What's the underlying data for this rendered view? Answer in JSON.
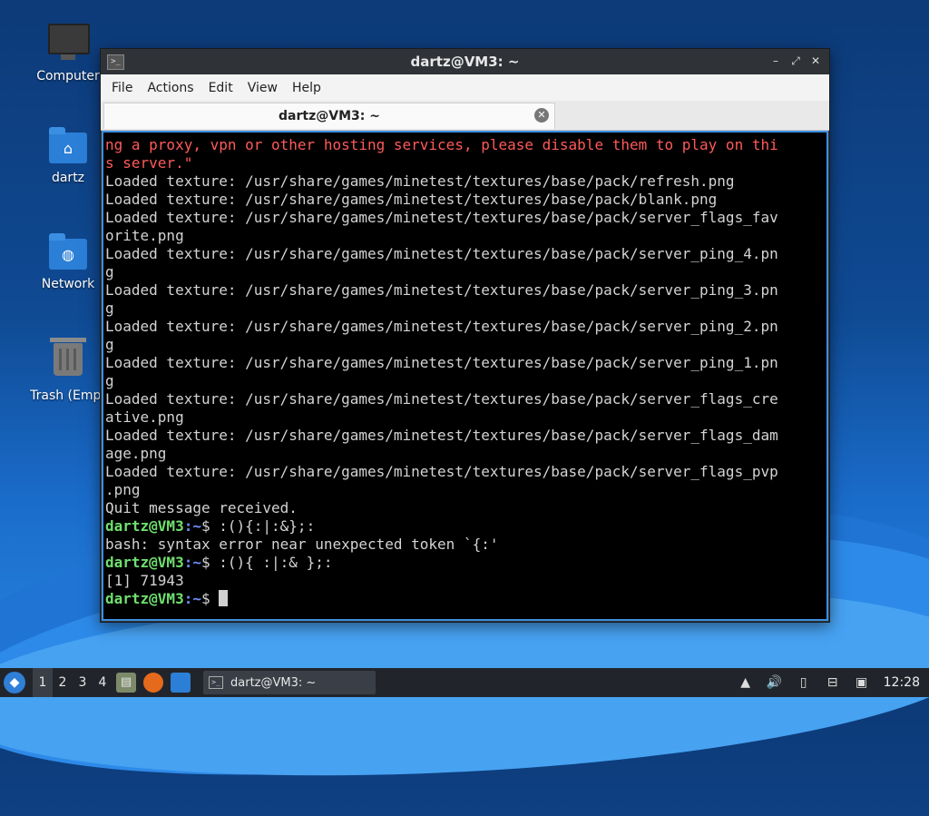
{
  "desktop": {
    "icons": [
      {
        "label": "Computer",
        "icon": "computer-icon"
      },
      {
        "label": "dartz",
        "icon": "home-folder-icon"
      },
      {
        "label": "Network",
        "icon": "network-folder-icon"
      },
      {
        "label": "Trash (Empt",
        "icon": "trash-icon"
      }
    ]
  },
  "window": {
    "title": "dartz@VM3: ~",
    "menu": [
      "File",
      "Actions",
      "Edit",
      "View",
      "Help"
    ],
    "tab_label": "dartz@VM3: ~",
    "controls": {
      "minimize": "–",
      "maximize": "⤢",
      "close": "✕"
    }
  },
  "terminal": {
    "error_lines": [
      "ng a proxy, vpn or other hosting services, please disable them to play on thi",
      "s server.\""
    ],
    "output_lines": [
      "Loaded texture: /usr/share/games/minetest/textures/base/pack/refresh.png",
      "Loaded texture: /usr/share/games/minetest/textures/base/pack/blank.png",
      "Loaded texture: /usr/share/games/minetest/textures/base/pack/server_flags_fav",
      "orite.png",
      "Loaded texture: /usr/share/games/minetest/textures/base/pack/server_ping_4.pn",
      "g",
      "Loaded texture: /usr/share/games/minetest/textures/base/pack/server_ping_3.pn",
      "g",
      "Loaded texture: /usr/share/games/minetest/textures/base/pack/server_ping_2.pn",
      "g",
      "Loaded texture: /usr/share/games/minetest/textures/base/pack/server_ping_1.pn",
      "g",
      "Loaded texture: /usr/share/games/minetest/textures/base/pack/server_flags_cre",
      "ative.png",
      "Loaded texture: /usr/share/games/minetest/textures/base/pack/server_flags_dam",
      "age.png",
      "Loaded texture: /usr/share/games/minetest/textures/base/pack/server_flags_pvp",
      ".png",
      "Quit message received."
    ],
    "prompt_user": "dartz@VM3",
    "prompt_path": ":~",
    "prompt_symbol": "$ ",
    "cmd1": ":(){:|:&};:",
    "cmd1_result": "bash: syntax error near unexpected token `{:'",
    "cmd2": ":(){ :|:& };:",
    "cmd2_result": "[1] 71943"
  },
  "taskbar": {
    "workspaces": [
      "1",
      "2",
      "3",
      "4"
    ],
    "active_workspace": "1",
    "task_label": "dartz@VM3: ~",
    "clock": "12:28"
  },
  "colors": {
    "error_text": "#ff5a5a",
    "prompt_user": "#6fe06f",
    "prompt_path": "#6f8fff",
    "terminal_border": "#3c8fe0"
  }
}
